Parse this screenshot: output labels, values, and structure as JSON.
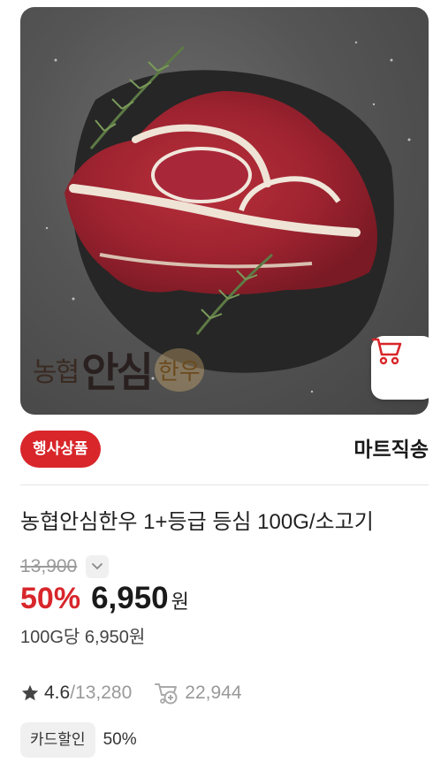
{
  "product": {
    "brand_logo_text": [
      "농협",
      "안심",
      "한우"
    ],
    "event_badge": "행사상품",
    "delivery_type": "마트직송",
    "name": "농협안심한우 1+등급 등심 100G/소고기",
    "original_price": "13,900",
    "discount_rate": "50%",
    "sale_price": "6,950",
    "currency": "원",
    "unit_price": "100G당 6,950원",
    "rating": "4.6",
    "review_count": "/13,280",
    "cart_count": "22,944",
    "card_discount_label": "카드할인",
    "card_discount_rate": "50%"
  },
  "icons": {
    "cart": "cart-icon",
    "chevron": "chevron-down-icon",
    "star": "star-icon",
    "cart_added": "cart-plus-icon"
  },
  "colors": {
    "accent": "#d8262a",
    "muted": "#999999"
  }
}
